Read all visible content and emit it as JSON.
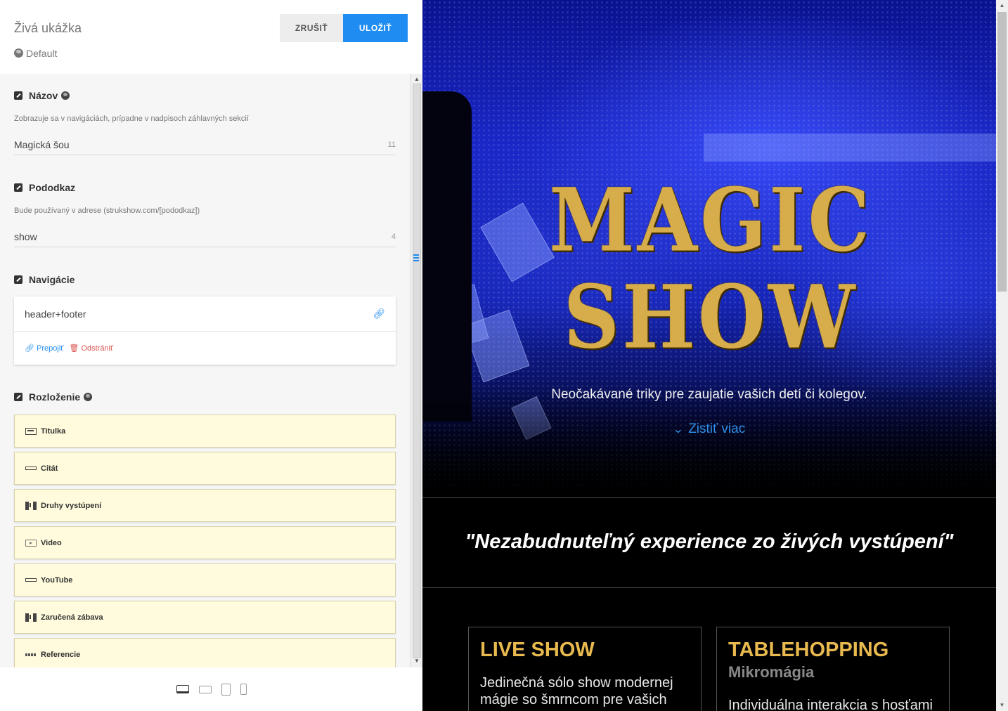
{
  "editor": {
    "title": "Živá ukážka",
    "theme": "Default",
    "cancel_label": "ZRUŠIŤ",
    "save_label": "ULOŽIŤ",
    "name_section": {
      "label": "Názov",
      "hint": "Zobrazuje sa v navigáciách, prípadne v nadpisoch záhlavných sekcií",
      "value": "Magická šou",
      "count": "11"
    },
    "subcommand_section": {
      "label": "Pododkaz",
      "hint": "Bude používaný v adrese (strukshow.com/[pododkaz])",
      "value": "show",
      "count": "4"
    },
    "navigation_section": {
      "label": "Navigácie",
      "value": "header+footer",
      "relink_label": "Prepojiť",
      "remove_label": "Odstrániť"
    },
    "layout_section": {
      "label": "Rozloženie",
      "items": [
        {
          "label": "Titulka",
          "icon": "hero-section-icon"
        },
        {
          "label": "Citát",
          "icon": "quote-section-icon"
        },
        {
          "label": "Druhy vystúpení",
          "icon": "columns-section-icon"
        },
        {
          "label": "Video",
          "icon": "video-section-icon"
        },
        {
          "label": "YouTube",
          "icon": "quote-section-icon"
        },
        {
          "label": "Zaručená zábava",
          "icon": "columns-section-icon"
        },
        {
          "label": "Referencie",
          "icon": "references-section-icon"
        }
      ]
    },
    "devices": [
      "desktop",
      "laptop",
      "tablet",
      "phone"
    ],
    "active_device": "desktop"
  },
  "preview": {
    "hero": {
      "title_line1": "MAGIC",
      "title_line2": "SHOW",
      "subtitle": "Neočakávané triky pre zaujatie vašich detí či kolegov.",
      "more_label": "Zistiť viac"
    },
    "quote": "\"Nezabudnuteľný experience zo živých vystúpení\"",
    "boxes": [
      {
        "title": "LIVE SHOW",
        "subtitle": "",
        "text": "Jedinečná sólo show modernej mágie so šmrncom pre vašich"
      },
      {
        "title": "TABLEHOPPING",
        "subtitle": "Mikromágia",
        "text": "Individuálna interakcia s hosťami"
      }
    ]
  },
  "colors": {
    "accent": "#1f8cf2",
    "gold": "#d6ad4a",
    "box_title": "#e8b94e",
    "layout_item_bg": "#fffbdc",
    "remove": "#d9534f"
  }
}
